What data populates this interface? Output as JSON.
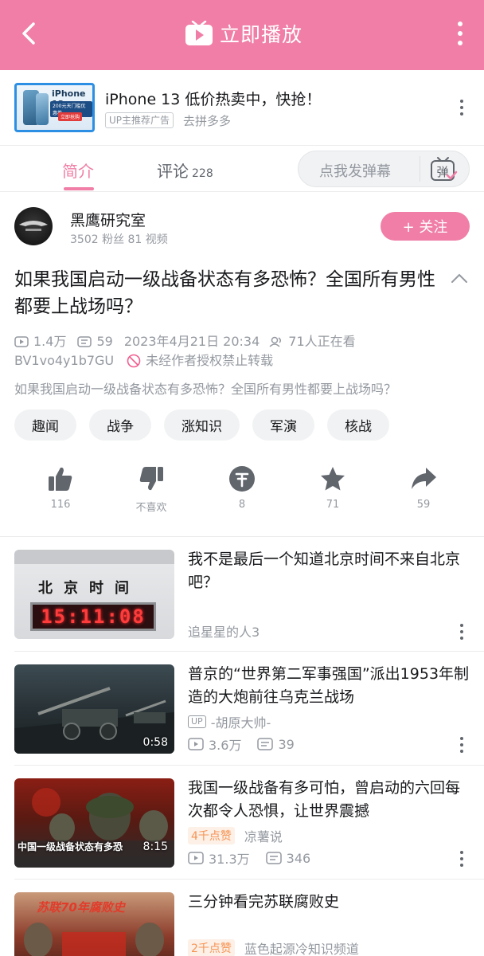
{
  "topbar": {
    "title": "立即播放",
    "colors": {
      "accent": "#f07ea6"
    }
  },
  "ad": {
    "thumb_text": "iPhone 13",
    "thumb_sub1": "200元天门槛优惠券",
    "thumb_sub2": "立即抢购",
    "title": "iPhone 13 低价热卖中，快抢！",
    "badge": "UP主推荐广告",
    "source": "去拼多多"
  },
  "tabs": {
    "intro": "简介",
    "comments": "评论",
    "comments_count": "228",
    "danmaku_placeholder": "点我发弹幕",
    "danmaku_icon_char": "弹"
  },
  "uploader": {
    "name": "黑鹰研究室",
    "stats": "3502 粉丝  81 视频",
    "follow_label": "+ 关注"
  },
  "video": {
    "title": "如果我国启动一级战备状态有多恐怖？全国所有男性都要上战场吗？",
    "views": "1.4万",
    "danmaku": "59",
    "date": "2023年4月21日  20:34",
    "watching": "71人正在看",
    "bvid": "BV1vo4y1b7GU",
    "no_repost": "未经作者授权禁止转载",
    "description": "如果我国启动一级战备状态有多恐怖？全国所有男性都要上战场吗？"
  },
  "tags": [
    "趣闻",
    "战争",
    "涨知识",
    "军演",
    "核战"
  ],
  "actions": {
    "like": "116",
    "dislike": "不喜欢",
    "coin": "8",
    "favorite": "71",
    "share": "59"
  },
  "related": [
    {
      "title": "我不是最后一个知道北京时间不来自北京吧？",
      "author": "追星星的人3",
      "thumb_label": "北京时间",
      "thumb_clock": "15:11:08"
    },
    {
      "title": "普京的“世界第二军事强国”派出1953年制造的大炮前往乌克兰战场",
      "author": "-胡原大帅-",
      "up_badge": "UP",
      "duration": "0:58",
      "views": "3.6万",
      "danmaku": "39"
    },
    {
      "title": "我国一级战备有多可怕，曾启动的六回每次都令人恐惧，让世界震撼",
      "hot": "4千点赞",
      "author": "凉薯说",
      "duration": "8:15",
      "thumb_caption": "中国一级战备状态有多恐",
      "views": "31.3万",
      "danmaku": "346"
    },
    {
      "title": "三分钟看完苏联腐败史",
      "hot": "2千点赞",
      "author": "蓝色起源冷知识频道",
      "thumb_caption": "苏联70年腐败史"
    }
  ]
}
